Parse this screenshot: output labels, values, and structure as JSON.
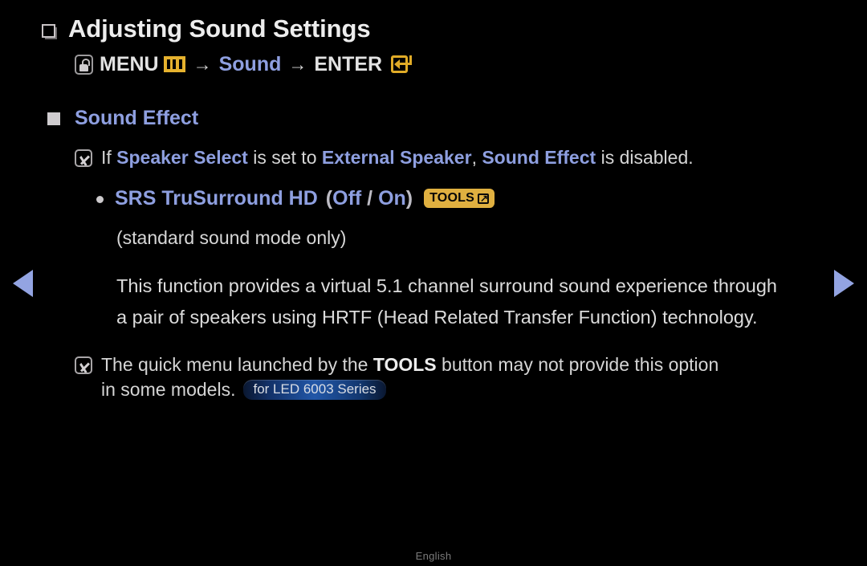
{
  "page": {
    "background_color": "#000000",
    "footer_language": "English"
  },
  "nav": {
    "prev_icon": "triangle-left-icon",
    "next_icon": "triangle-right-icon",
    "arrow_color": "#93a4e2"
  },
  "heading": {
    "bullet_icon": "hollow-square-bullet",
    "title": "Adjusting Sound Settings"
  },
  "menu_path": {
    "press_icon": "press-button-icon",
    "menu_label": "MENU",
    "menu_icon": "menu-bars-icon",
    "arrow1": "→",
    "target_label": "Sound",
    "arrow2": "→",
    "enter_label": "ENTER",
    "enter_icon": "enter-return-icon",
    "accent_color": "#8e9fe0",
    "gold_color": "#e0ab27"
  },
  "section": {
    "bullet_icon": "filled-square-bullet",
    "title": "Sound Effect",
    "title_color": "#8e9fe0"
  },
  "notes": [
    {
      "icon": "note-pencil-icon",
      "segments": [
        {
          "text": "If ",
          "style": "normal"
        },
        {
          "text": "Speaker Select",
          "style": "accent-bold"
        },
        {
          "text": " is set to ",
          "style": "normal"
        },
        {
          "text": "External Speaker",
          "style": "accent-bold"
        },
        {
          "text": ", ",
          "style": "normal"
        },
        {
          "text": "Sound Effect",
          "style": "accent-bold"
        },
        {
          "text": " is disabled.",
          "style": "normal"
        }
      ]
    }
  ],
  "option": {
    "bullet_icon": "round-dot-bullet",
    "name": "SRS TruSurround HD",
    "values_open": "(",
    "value_off": "Off",
    "value_sep": " / ",
    "value_on": "On",
    "values_close": ")",
    "badge": {
      "label": "TOOLS",
      "icon": "tools-shortcut-icon",
      "bg_color": "#e0b040",
      "text_color": "#060606"
    },
    "subtitle": "(standard sound mode only)",
    "description_line1": "This function provides a virtual 5.1 channel surround sound experience through",
    "description_line2": "a pair of speakers using HRTF (Head Related Transfer Function) technology."
  },
  "bottom_note": {
    "icon": "note-pencil-icon",
    "line1_segments": [
      {
        "text": "The quick menu launched by the ",
        "style": "normal"
      },
      {
        "text": "TOOLS",
        "style": "bold"
      },
      {
        "text": " button may not provide this option",
        "style": "normal"
      }
    ],
    "line2_text": "in some models.",
    "series_badge": {
      "label": "for LED 6003 Series",
      "text_color": "#d9dde4"
    }
  }
}
